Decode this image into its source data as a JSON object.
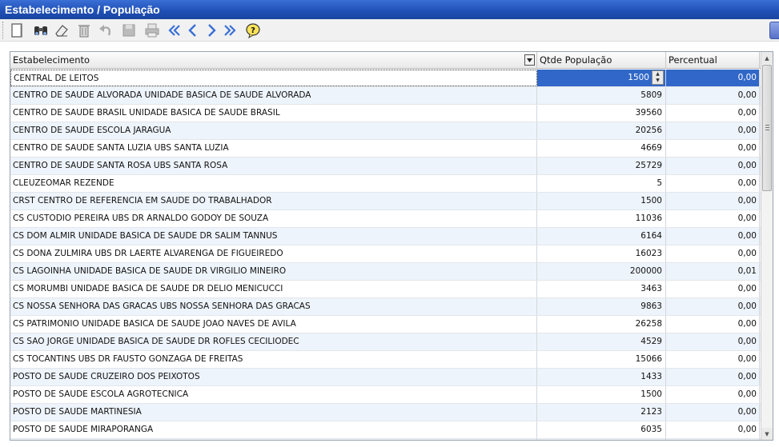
{
  "window": {
    "title": "Estabelecimento / População"
  },
  "toolbar": {
    "buttons": [
      {
        "icon": "new-icon"
      },
      {
        "icon": "binoculars-icon"
      },
      {
        "icon": "eraser-icon"
      },
      {
        "icon": "trash-icon"
      },
      {
        "icon": "undo-icon"
      },
      {
        "icon": "save-icon"
      },
      {
        "icon": "print-icon"
      },
      {
        "icon": "first-icon"
      },
      {
        "icon": "previous-icon"
      },
      {
        "icon": "next-icon"
      },
      {
        "icon": "last-icon"
      },
      {
        "icon": "help-icon"
      }
    ]
  },
  "grid": {
    "columns": [
      "Estabelecimento",
      "Qtde População",
      "Percentual"
    ],
    "rows": [
      [
        "CENTRAL DE LEITOS",
        "1500",
        "0,00"
      ],
      [
        "CENTRO DE SAUDE ALVORADA UNIDADE BASICA DE SAUDE ALVORADA",
        "5809",
        "0,00"
      ],
      [
        "CENTRO DE SAUDE BRASIL UNIDADE BASICA DE SAUDE BRASIL",
        "39560",
        "0,00"
      ],
      [
        "CENTRO DE SAUDE ESCOLA JARAGUA",
        "20256",
        "0,00"
      ],
      [
        "CENTRO DE SAUDE SANTA LUZIA UBS SANTA LUZIA",
        "4669",
        "0,00"
      ],
      [
        "CENTRO DE SAUDE SANTA ROSA UBS SANTA ROSA",
        "25729",
        "0,00"
      ],
      [
        "CLEUZEOMAR REZENDE",
        "5",
        "0,00"
      ],
      [
        "CRST CENTRO DE REFERENCIA EM SAUDE DO TRABALHADOR",
        "1500",
        "0,00"
      ],
      [
        "CS CUSTODIO PEREIRA UBS DR ARNALDO GODOY DE SOUZA",
        "11036",
        "0,00"
      ],
      [
        "CS DOM ALMIR UNIDADE BASICA DE SAUDE DR SALIM TANNUS",
        "6164",
        "0,00"
      ],
      [
        "CS DONA ZULMIRA UBS DR LAERTE ALVARENGA DE FIGUEIREDO",
        "16023",
        "0,00"
      ],
      [
        "CS LAGOINHA UNIDADE BASICA DE SAUDE DR VIRGILIO MINEIRO",
        "200000",
        "0,01"
      ],
      [
        "CS MORUMBI UNIDADE BASICA DE SAUDE DR DELIO MENICUCCI",
        "3463",
        "0,00"
      ],
      [
        "CS NOSSA SENHORA DAS GRACAS UBS NOSSA SENHORA DAS GRACAS",
        "9863",
        "0,00"
      ],
      [
        "CS PATRIMONIO UNIDADE BASICA DE SAUDE JOAO NAVES DE AVILA",
        "26258",
        "0,00"
      ],
      [
        "CS SAO JORGE UNIDADE BASICA DE SAUDE DR ROFLES CECILIODEC",
        "4529",
        "0,00"
      ],
      [
        "CS TOCANTINS UBS DR FAUSTO GONZAGA DE FREITAS",
        "15066",
        "0,00"
      ],
      [
        "POSTO DE SAUDE CRUZEIRO DOS PEIXOTOS",
        "1433",
        "0,00"
      ],
      [
        "POSTO DE SAUDE ESCOLA AGROTECNICA",
        "1500",
        "0,00"
      ],
      [
        "POSTO DE SAUDE MARTINESIA",
        "2123",
        "0,00"
      ],
      [
        "POSTO DE SAUDE MIRAPORANGA",
        "6035",
        "0,00"
      ],
      [
        "",
        "",
        ""
      ]
    ]
  }
}
